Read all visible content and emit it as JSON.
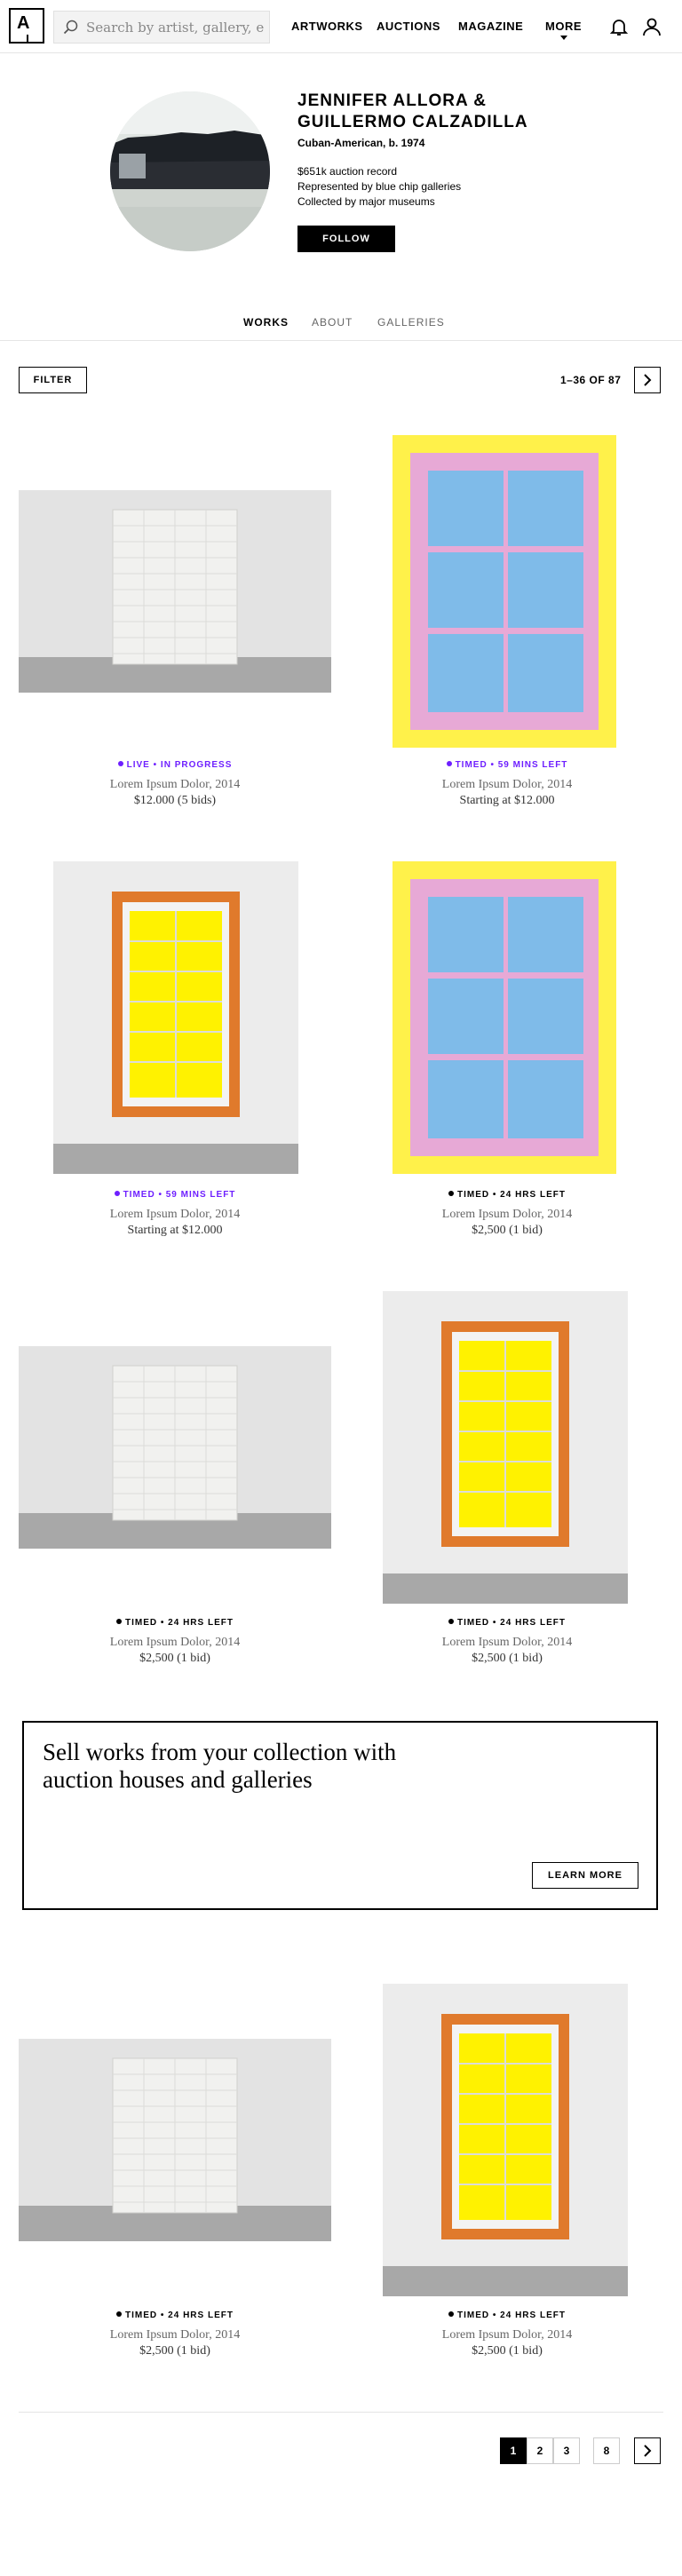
{
  "header": {
    "search_placeholder": "Search by artist, gallery, etc.",
    "nav": [
      "ARTWORKS",
      "AUCTIONS",
      "MAGAZINE",
      "MORE"
    ]
  },
  "artist": {
    "name": "JENNIFER ALLORA & GUILLERMO CALZADILLA",
    "meta": "Cuban-American, b. 1974",
    "stats": [
      "$651k auction record",
      "Represented by blue chip galleries",
      "Collected by major museums"
    ],
    "follow_label": "FOLLOW"
  },
  "tabs": [
    "WORKS",
    "ABOUT",
    "GALLERIES"
  ],
  "results": {
    "filter_label": "FILTER",
    "count": "1–36 OF 87"
  },
  "artworks": [
    {
      "status": "LIVE • IN PROGRESS",
      "title": "Lorem Ipsum Dolor, 2014",
      "price": "$12.000 (5 bids)"
    },
    {
      "status": "TIMED • 59 MINS LEFT",
      "title": "Lorem Ipsum Dolor, 2014",
      "price": "Starting at $12.000"
    },
    {
      "status": "TIMED • 59 MINS LEFT",
      "title": "Lorem Ipsum Dolor, 2014",
      "price": "Starting at $12.000"
    },
    {
      "status": "TIMED • 24 HRS LEFT",
      "title": "Lorem Ipsum Dolor, 2014",
      "price": "$2,500 (1 bid)"
    },
    {
      "status": "TIMED • 24 HRS LEFT",
      "title": "Lorem Ipsum Dolor, 2014",
      "price": "$2,500 (1 bid)"
    },
    {
      "status": "TIMED • 24 HRS LEFT",
      "title": "Lorem Ipsum Dolor, 2014",
      "price": "$2,500 (1 bid)"
    },
    {
      "status": "TIMED • 24 HRS LEFT",
      "title": "Lorem Ipsum Dolor, 2014",
      "price": "$2,500 (1 bid)"
    },
    {
      "status": "TIMED • 24 HRS LEFT",
      "title": "Lorem Ipsum Dolor, 2014",
      "price": "$2,500 (1 bid)"
    }
  ],
  "consign": {
    "text": "Sell works from your collection with auction houses and galleries",
    "button": "LEARN MORE"
  },
  "pagination": [
    "1",
    "2",
    "3",
    "8"
  ],
  "colors": {
    "live": "#6e1fff",
    "timed": "#000000"
  }
}
